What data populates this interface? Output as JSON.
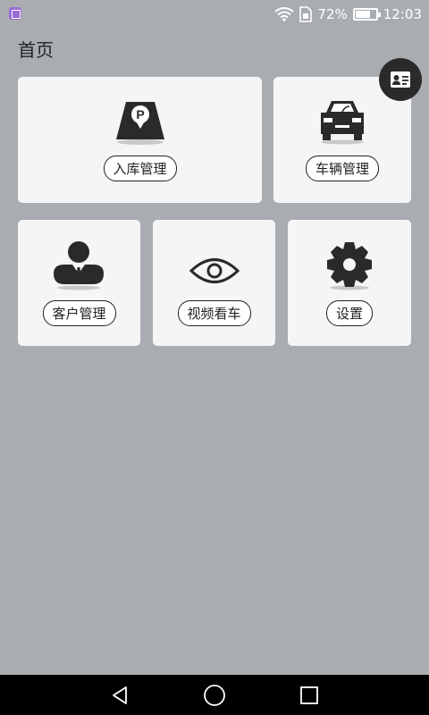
{
  "status_bar": {
    "battery_percent": "72%",
    "battery_level": 0.72,
    "time": "12:03"
  },
  "header": {
    "title": "首页"
  },
  "cards": {
    "parking_in": {
      "label": "入库管理",
      "icon": "parking-icon"
    },
    "vehicle": {
      "label": "车辆管理",
      "icon": "car-icon"
    },
    "customer": {
      "label": "客户管理",
      "icon": "person-icon"
    },
    "video": {
      "label": "视频看车",
      "icon": "eye-icon"
    },
    "settings": {
      "label": "设置",
      "icon": "gear-icon"
    }
  },
  "fab": {
    "icon": "id-card-icon"
  },
  "nav": {
    "back": "back-icon",
    "home": "home-icon",
    "recents": "recents-icon"
  },
  "colors": {
    "background": "#a9adb1",
    "card": "#f5f5f5",
    "icon": "#2a2a2a",
    "nav": "#000000"
  }
}
